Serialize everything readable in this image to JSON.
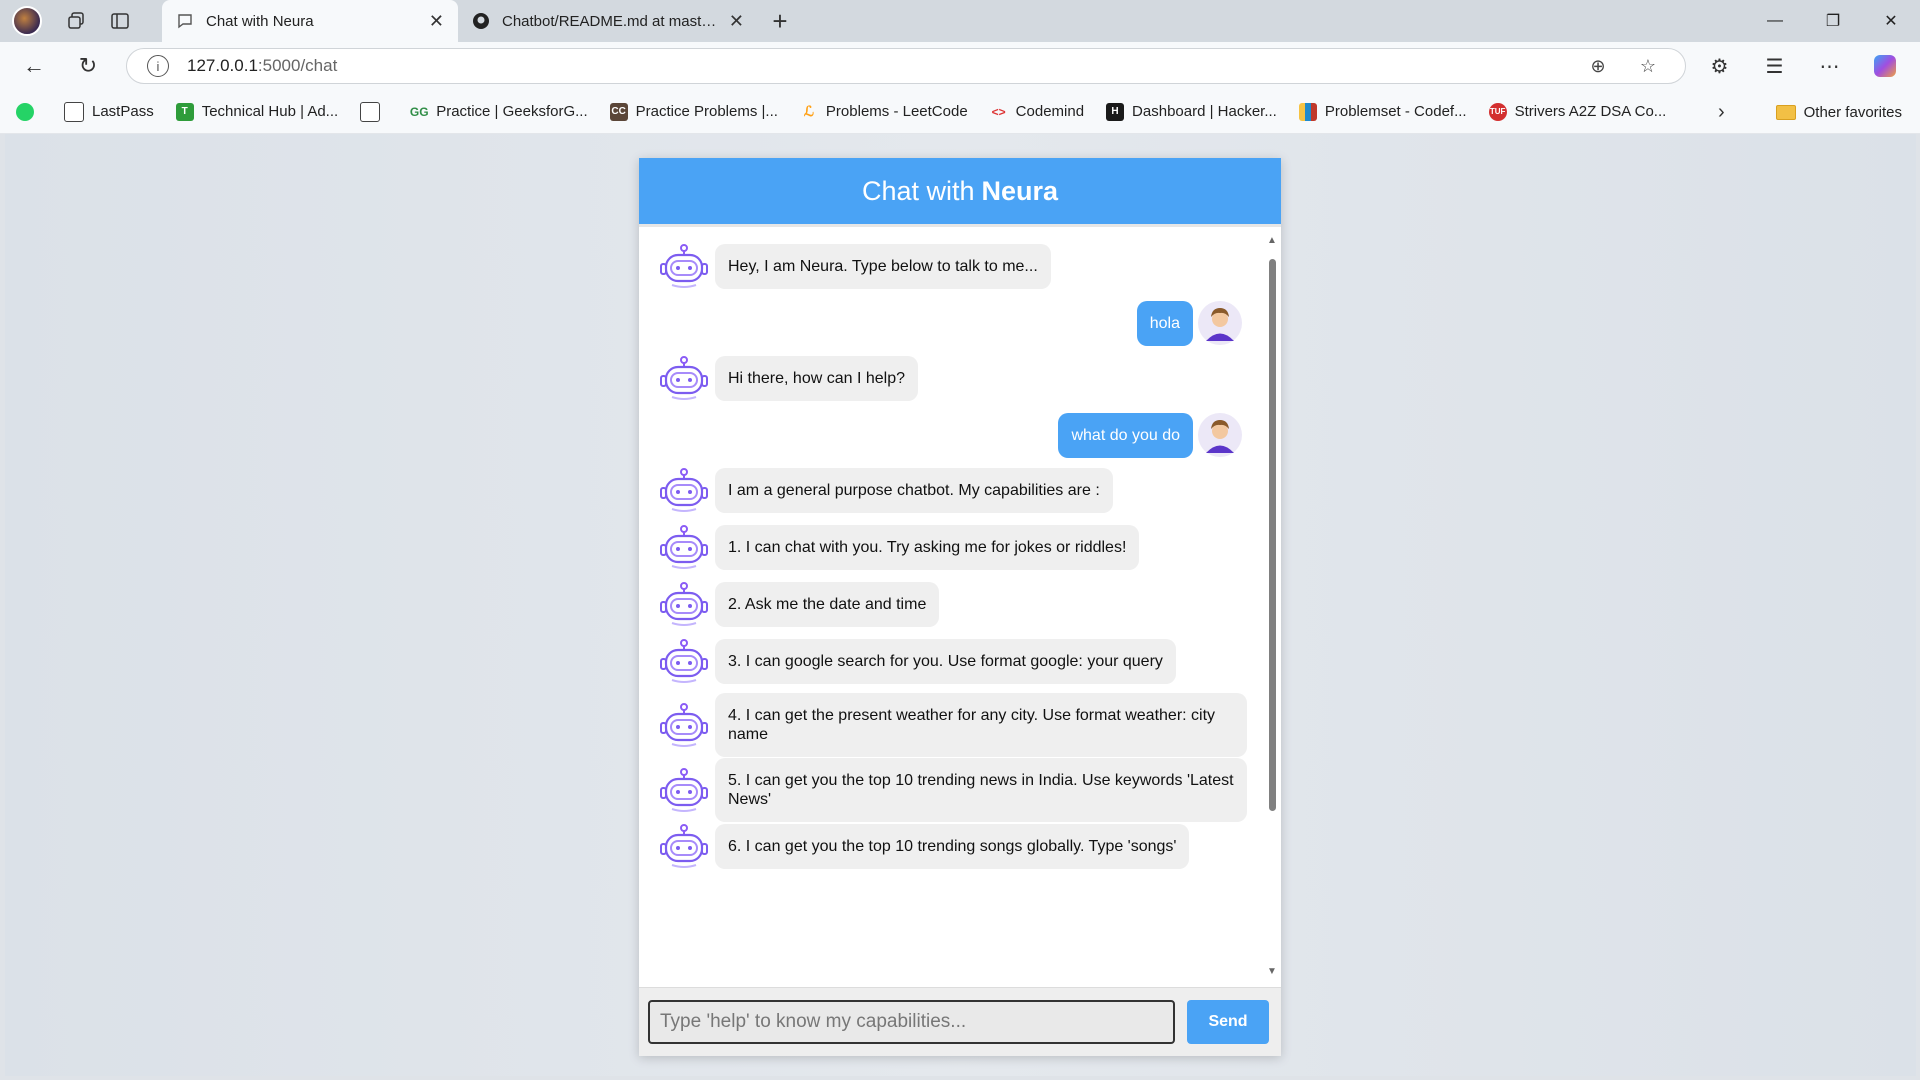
{
  "browser": {
    "tabs": [
      {
        "title": "Chat with Neura",
        "active": true
      },
      {
        "title": "Chatbot/README.md at master · ",
        "active": false
      }
    ],
    "url_host": "127.0.0.1",
    "url_rest": ":5000/chat",
    "bookmarks": [
      {
        "label": "",
        "icon": "whatsapp-icon",
        "color": "#25d366"
      },
      {
        "label": "LastPass",
        "icon": "page-icon",
        "color": "#ffffff"
      },
      {
        "label": "Technical Hub | Ad...",
        "icon": "th-icon",
        "color": "#2e9c3a"
      },
      {
        "label": "",
        "icon": "page-icon",
        "color": "#ffffff"
      },
      {
        "label": "Practice | GeeksforG...",
        "icon": "gfg-icon",
        "color": "#2f8d46"
      },
      {
        "label": "Practice Problems |...",
        "icon": "cc-icon",
        "color": "#5b4638"
      },
      {
        "label": "Problems - LeetCode",
        "icon": "leetcode-icon",
        "color": "#ffa116"
      },
      {
        "label": "Codemind",
        "icon": "codemind-icon",
        "color": "#d33"
      },
      {
        "label": "Dashboard | Hacker...",
        "icon": "hackerrank-icon",
        "color": "#1a1a1a"
      },
      {
        "label": "Problemset - Codef...",
        "icon": "codeforces-icon",
        "color": "#1f8acb"
      },
      {
        "label": "Strivers A2Z DSA Co...",
        "icon": "tuf-icon",
        "color": "#d32f2f"
      }
    ],
    "other_favorites": "Other favorites"
  },
  "chat": {
    "header_prefix": "Chat with",
    "header_name": "Neura",
    "messages": [
      {
        "from": "bot",
        "text": "Hey, I am Neura. Type below to talk to me..."
      },
      {
        "from": "user",
        "text": "hola"
      },
      {
        "from": "bot",
        "text": "Hi there, how can I help?"
      },
      {
        "from": "user",
        "text": "what do you do"
      },
      {
        "from": "bot",
        "text": "I am a general purpose chatbot. My capabilities are :"
      },
      {
        "from": "bot",
        "text": "1. I can chat with you. Try asking me for jokes or riddles!"
      },
      {
        "from": "bot",
        "text": "2. Ask me the date and time"
      },
      {
        "from": "bot",
        "text": "3. I can google search for you. Use format google: your query"
      },
      {
        "from": "bot",
        "text": "4. I can get the present weather for any city. Use format weather: city name"
      },
      {
        "from": "bot",
        "text": "5. I can get you the top 10 trending news in India. Use keywords 'Latest News'"
      },
      {
        "from": "bot",
        "text": "6. I can get you the top 10 trending songs globally. Type 'songs'"
      }
    ],
    "input_placeholder": "Type 'help' to know my capabilities...",
    "send_label": "Send"
  },
  "colors": {
    "accent": "#4aa3f5",
    "bot_bubble": "#efefef"
  }
}
